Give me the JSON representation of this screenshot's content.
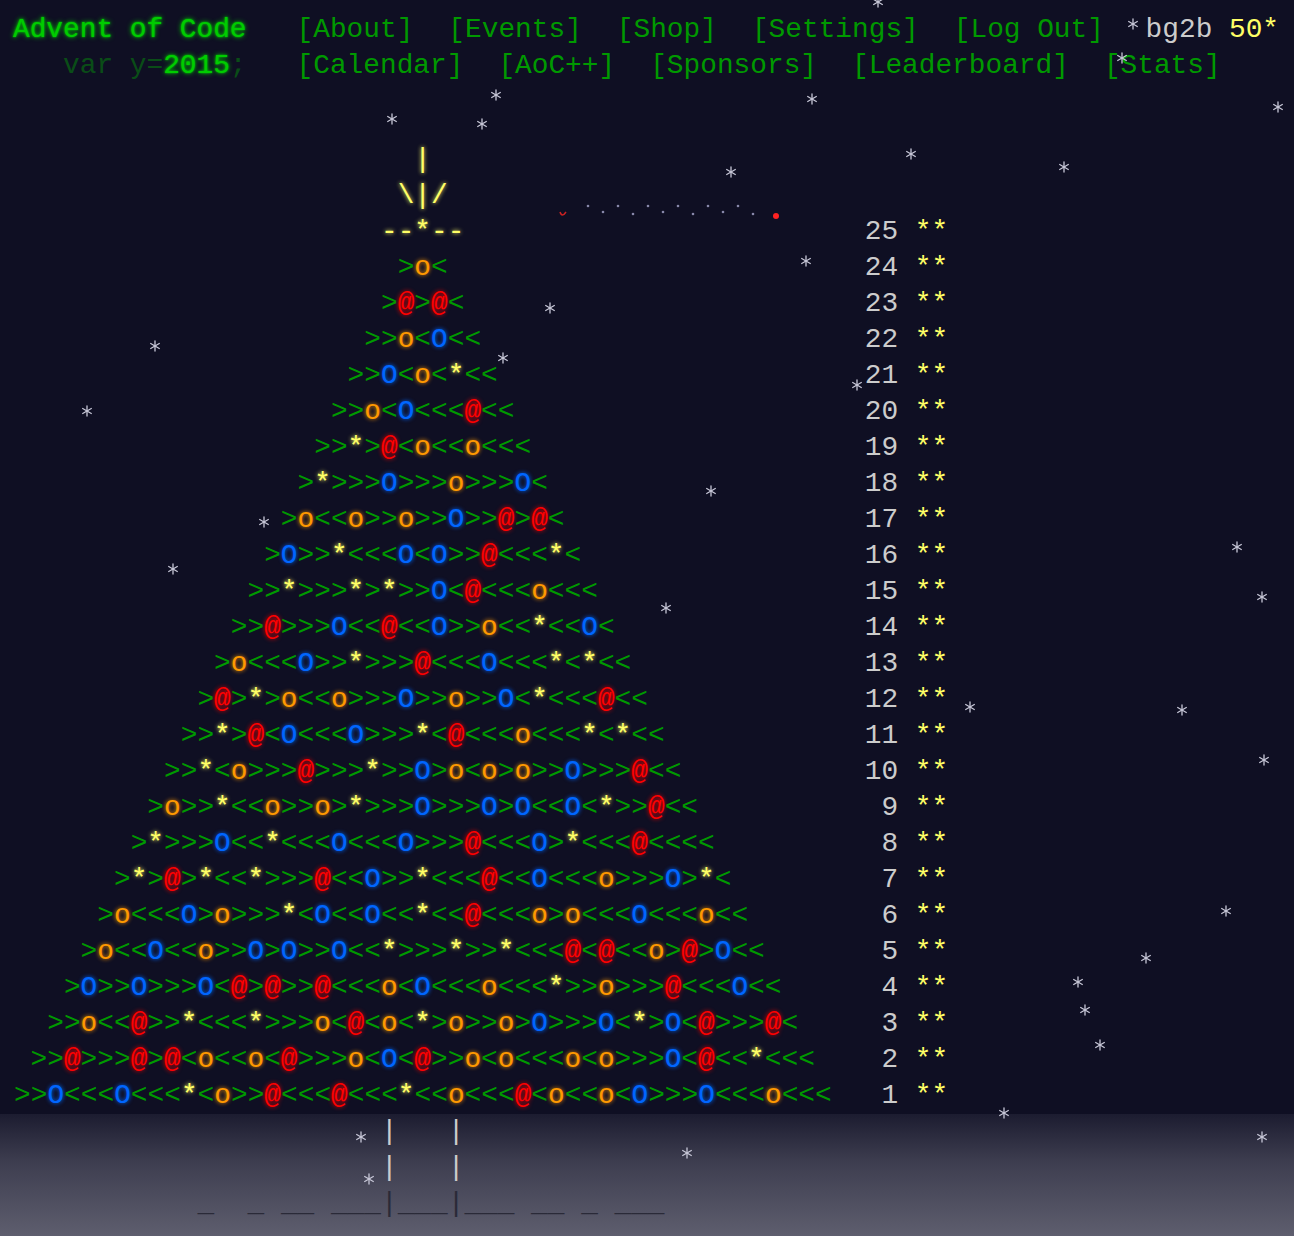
{
  "header": {
    "title": "Advent of Code",
    "year": {
      "prefix": "var y=",
      "value": "2015",
      "suffix": ";"
    },
    "nav": [
      {
        "label": "[About]"
      },
      {
        "label": "[Events]"
      },
      {
        "label": "[Shop]"
      },
      {
        "label": "[Settings]"
      },
      {
        "label": "[Log Out]"
      }
    ],
    "nav_secondary": [
      {
        "label": "[Calendar]"
      },
      {
        "label": "[AoC++]"
      },
      {
        "label": "[Sponsors]"
      },
      {
        "label": "[Leaderboard]"
      },
      {
        "label": "[Stats]"
      }
    ],
    "user": "bg2b",
    "star_count": "50*"
  },
  "calendar": {
    "topper": [
      "|",
      "\\|/"
    ],
    "days": [
      {
        "day": "25",
        "art": "--*--",
        "stars": 2,
        "stars_label": "**"
      },
      {
        "day": "24",
        "art": ">o<",
        "stars": 2,
        "stars_label": "**"
      },
      {
        "day": "23",
        "art": ">@>@<",
        "stars": 2,
        "stars_label": "**"
      },
      {
        "day": "22",
        "art": ">>o<O<<",
        "stars": 2,
        "stars_label": "**"
      },
      {
        "day": "21",
        "art": ">>O<o<*<<",
        "stars": 2,
        "stars_label": "**"
      },
      {
        "day": "20",
        "art": ">>o<O<<<@<<",
        "stars": 2,
        "stars_label": "**"
      },
      {
        "day": "19",
        "art": ">>*>@<o<<o<<<",
        "stars": 2,
        "stars_label": "**"
      },
      {
        "day": "18",
        "art": ">*>>>O>>>o>>>O<",
        "stars": 2,
        "stars_label": "**"
      },
      {
        "day": "17",
        "art": ">o<<o>>o>>O>>@>@<",
        "stars": 2,
        "stars_label": "**"
      },
      {
        "day": "16",
        "art": ">O>>*<<<O<O>>@<<<*<",
        "stars": 2,
        "stars_label": "**"
      },
      {
        "day": "15",
        "art": ">>*>>>*>*>>O<@<<<o<<<",
        "stars": 2,
        "stars_label": "**"
      },
      {
        "day": "14",
        "art": ">>@>>>O<<@<<O>>o<<*<<O<",
        "stars": 2,
        "stars_label": "**"
      },
      {
        "day": "13",
        "art": ">o<<<O>>*>>>@<<<O<<<*<*<<",
        "stars": 2,
        "stars_label": "**"
      },
      {
        "day": "12",
        "art": ">@>*>o<<o>>>O>>o>>O<*<<<@<<",
        "stars": 2,
        "stars_label": "**"
      },
      {
        "day": "11",
        "art": ">>*>@<O<<<O>>>*<@<<<o<<<*<*<<",
        "stars": 2,
        "stars_label": "**"
      },
      {
        "day": "10",
        "art": ">>*<o>>>@>>>*>>O>o<o>o>>O>>>@<<",
        "stars": 2,
        "stars_label": "**"
      },
      {
        "day": "9",
        "art": ">o>>*<<o>>o>*>>>O>>>O>O<<O<*>>@<<",
        "stars": 2,
        "stars_label": "**"
      },
      {
        "day": "8",
        "art": ">*>>>O<<*<<<O<<<O>>>@<<<O>*<<<@<<<<",
        "stars": 2,
        "stars_label": "**"
      },
      {
        "day": "7",
        "art": ">*>@>*<<*>>>@<<O>>*<<<@<<O<<<o>>>O>*<",
        "stars": 2,
        "stars_label": "**"
      },
      {
        "day": "6",
        "art": ">o<<<O>o>>>*<O<<O<<*<<@<<<o>o<<<O<<<o<<",
        "stars": 2,
        "stars_label": "**"
      },
      {
        "day": "5",
        "art": ">o<<O<<o>>O>O>>O<<*>>>*>>*<<<@<@<<o>@>O<<",
        "stars": 2,
        "stars_label": "**"
      },
      {
        "day": "4",
        "art": ">O>>O>>>O<@>@>>@<<<o<O<<<o<<<*>>o>>>@<<<O<<",
        "stars": 2,
        "stars_label": "**"
      },
      {
        "day": "3",
        "art": ">>o<<@>>*<<<*>>>o<@<o<*>o>>o>O>>>O<*>O<@>>>@<",
        "stars": 2,
        "stars_label": "**"
      },
      {
        "day": "2",
        "art": ">>@>>>@>@<o<<o<@>>>o<O<@>>o<o<<<o<o>>>O<@<<*<<<",
        "stars": 2,
        "stars_label": "**"
      },
      {
        "day": "1",
        "art": ">>O<<<O<<<*<o>>@<<<@<<<*<<o<<<@<o<<o<O>>>O<<<o<<<",
        "stars": 2,
        "stars_label": "**"
      }
    ],
    "trunk": [
      "|   |",
      "|   |"
    ],
    "ground": "_  _ __ ___|___|___ __ _ ___"
  }
}
